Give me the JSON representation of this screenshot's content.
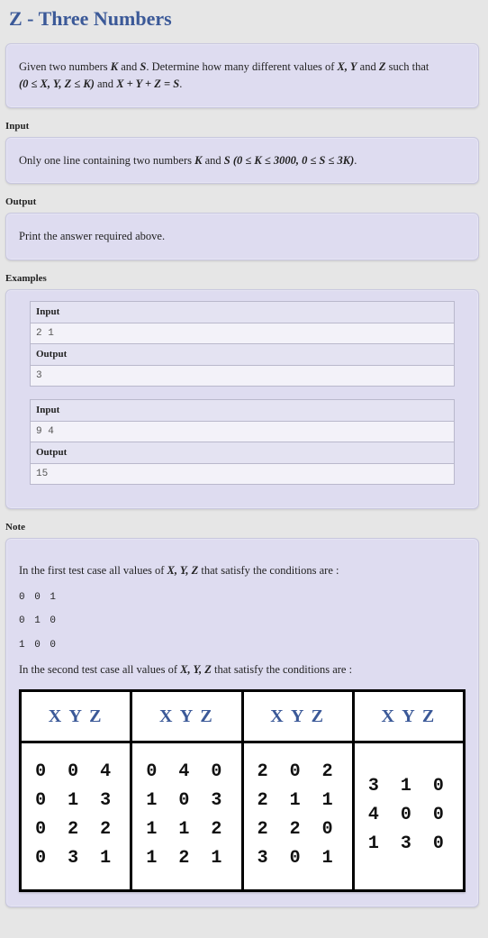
{
  "title": "Z - Three Numbers",
  "statement": {
    "line1_a": "Given two numbers ",
    "K": "K",
    "and1": " and ",
    "S": "S",
    "line1_b": ". Determine how many different values of ",
    "XYZ": "X, Y",
    "and2": " and ",
    "Z": "Z",
    "line1_c": " such that",
    "formula1": "(0 ≤ X, Y, Z ≤ K)",
    "mid": " and ",
    "formula2": "X + Y + Z = S",
    "end": "."
  },
  "input": {
    "heading": "Input",
    "text_a": "Only one line containing two numbers ",
    "K": "K",
    "and": " and ",
    "S": "S",
    "space": " ",
    "constraint": "(0 ≤ K ≤ 3000, 0 ≤ S ≤ 3K)",
    "end": "."
  },
  "output": {
    "heading": "Output",
    "text": "Print the answer required above."
  },
  "examples": {
    "heading": "Examples",
    "samples": [
      {
        "input": "2 1",
        "output": "3"
      },
      {
        "input": "9 4",
        "output": "15"
      }
    ],
    "labels": {
      "input": "Input",
      "output": "Output"
    }
  },
  "note": {
    "heading": "Note",
    "p1_a": "In the first test case all values of ",
    "p1_b": "X, Y, Z",
    "p1_c": " that satisfy the conditions are :",
    "triplets1": [
      "0 0 1",
      "0 1 0",
      "1 0 0"
    ],
    "p2_a": "In the second test case all values of ",
    "p2_b": "X, Y, Z",
    "p2_c": " that satisfy the conditions are :",
    "table": {
      "header": "X Y Z",
      "columns": [
        [
          "0 0 4",
          "0 1 3",
          "0 2 2",
          "0 3 1"
        ],
        [
          "0 4 0",
          "1 0 3",
          "1 1 2",
          "1 2 1"
        ],
        [
          "2 0 2",
          "2 1 1",
          "2 2 0",
          "3 0 1"
        ],
        [
          "3 1 0",
          "4 0 0",
          "1 3 0"
        ]
      ]
    }
  }
}
